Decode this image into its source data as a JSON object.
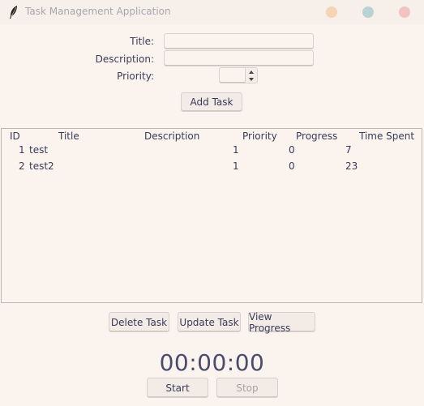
{
  "window": {
    "title": "Task Management Application",
    "feather_icon": "feather-icon"
  },
  "form": {
    "title_label": "Title:",
    "title_value": "",
    "description_label": "Description:",
    "description_value": "",
    "priority_label": "Priority:",
    "priority_value": "",
    "add_button": "Add Task"
  },
  "table": {
    "columns": [
      "ID",
      "Title",
      "Description",
      "Priority",
      "Progress",
      "Time Spent"
    ],
    "rows": [
      {
        "id": "1",
        "title": "test",
        "description": "",
        "priority": "1",
        "progress": "0",
        "time_spent": "7"
      },
      {
        "id": "2",
        "title": "test2",
        "description": "",
        "priority": "1",
        "progress": "0",
        "time_spent": "23"
      }
    ]
  },
  "actions": {
    "delete_button": "Delete Task",
    "update_button": "Update Task",
    "view_progress_button": "View Progress"
  },
  "timer": {
    "display": "00:00:00",
    "start_button": "Start",
    "stop_button": "Stop"
  },
  "colors": {
    "background": "#faf3ee",
    "minimize": "#f4d4b2",
    "maximize": "#b9d3d3",
    "close": "#f1c4c2"
  }
}
